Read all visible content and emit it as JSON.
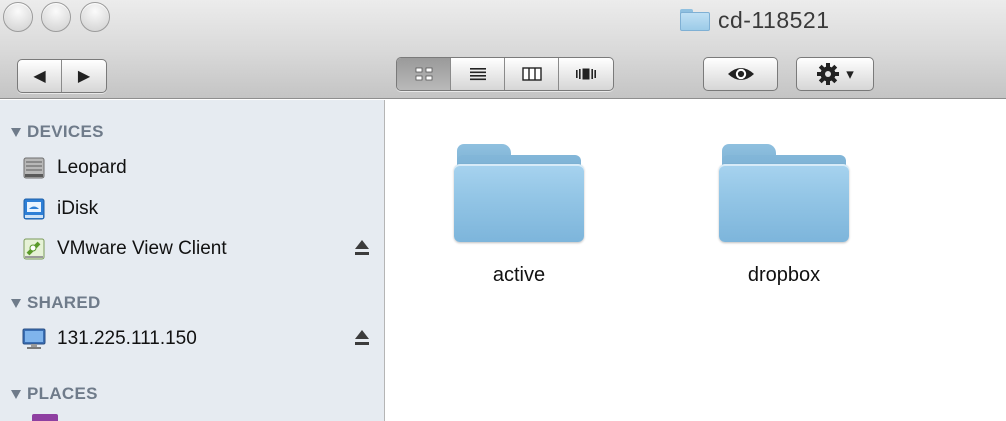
{
  "window": {
    "title": "cd-118521"
  },
  "toolbar": {
    "nav": {
      "back_glyph": "◀",
      "forward_glyph": "▶"
    },
    "views": [
      "icon-view",
      "list-view",
      "column-view",
      "cover-flow-view"
    ],
    "active_view": "icon-view",
    "quick_look_icon": "eye-icon",
    "action_icon": "gear-icon",
    "action_caret": "▾"
  },
  "sidebar": {
    "sections": [
      {
        "title": "DEVICES",
        "items": [
          {
            "label": "Leopard",
            "icon": "hard-drive-icon",
            "eject": false
          },
          {
            "label": "iDisk",
            "icon": "idisk-icon",
            "eject": false
          },
          {
            "label": "VMware View Client",
            "icon": "disk-image-icon",
            "eject": true
          }
        ]
      },
      {
        "title": "SHARED",
        "items": [
          {
            "label": "131.225.111.150",
            "icon": "network-computer-icon",
            "eject": true
          }
        ]
      },
      {
        "title": "PLACES",
        "items": []
      }
    ]
  },
  "content": {
    "files": [
      {
        "name": "active",
        "type": "folder"
      },
      {
        "name": "dropbox",
        "type": "folder"
      }
    ]
  },
  "colors": {
    "folder_blue": "#94c6e6",
    "sidebar_bg": "#e6ebf1",
    "section_header": "#6f7b8a"
  }
}
